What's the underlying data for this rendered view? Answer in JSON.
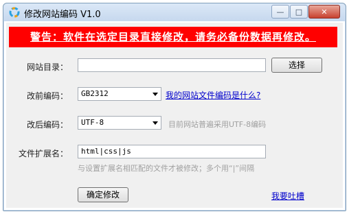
{
  "window": {
    "title": "修改网站编码 V1.0",
    "controls": {
      "minimize": "—",
      "maximize": "□",
      "close": "✕"
    }
  },
  "warning": "警告：软件在选定目录直接修改，请务必备份数据再修改。",
  "site_dir": {
    "label": "网站目录：",
    "value": "",
    "browse_button": "选择"
  },
  "before_encoding": {
    "label": "改前编码：",
    "selected": "GB2312",
    "help_link": "我的网站文件编码是什么?"
  },
  "after_encoding": {
    "label": "改后编码：",
    "selected": "UTF-8",
    "note": "目前网站普遍采用UTF-8编码"
  },
  "extensions": {
    "label": "文件扩展名：",
    "value": "html|css|js",
    "hint": "与设置扩展名相匹配的文件才被修改；多个用“|”间隔"
  },
  "actions": {
    "confirm_button": "确定修改",
    "feedback_link": "我要吐槽"
  },
  "colors": {
    "warning_bg": "#ff0000",
    "link": "#0000cc",
    "hint": "#a0a0a0"
  }
}
